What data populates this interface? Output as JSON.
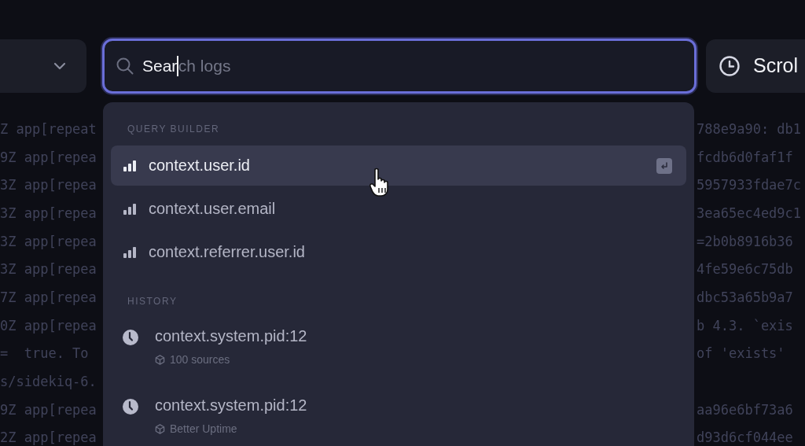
{
  "search": {
    "value": "Sear",
    "completion": "ch logs"
  },
  "right_button": {
    "label": "Scrol"
  },
  "log_lines": [
    {
      "left": "Z app[repeat",
      "right": "788e9a90: db1"
    },
    {
      "left": "9Z app[repea",
      "right": "fcdb6d0faf1f"
    },
    {
      "left": "3Z app[repea",
      "right": "5957933fdae7c"
    },
    {
      "left": "3Z app[repea",
      "right": "3ea65ec4ed9c1"
    },
    {
      "left": "3Z app[repea",
      "right": "=2b0b8916b36"
    },
    {
      "left": "3Z app[repea",
      "right": "4fe59e6c75db"
    },
    {
      "left": "7Z app[repea",
      "right": "dbc53a65b9a7"
    },
    {
      "left": "0Z app[repea",
      "right": "b 4.3. `exis"
    },
    {
      "left": "=  true. To",
      "right": "of 'exists'"
    },
    {
      "left": "s/sidekiq-6."
    },
    {
      "left": "9Z app[repea",
      "right": "aa96e6bf73a6"
    },
    {
      "left": "2Z app[repea",
      "right": "d93d6cf044ee"
    }
  ],
  "dropdown": {
    "sections": [
      {
        "title": "QUERY BUILDER",
        "items": [
          {
            "kind": "field",
            "label": "context.user.id",
            "selected": true
          },
          {
            "kind": "field",
            "label": "context.user.email",
            "selected": false
          },
          {
            "kind": "field",
            "label": "context.referrer.user.id",
            "selected": false
          }
        ]
      },
      {
        "title": "HISTORY",
        "items": [
          {
            "kind": "history",
            "label": "context.system.pid:12",
            "sub": "100 sources",
            "selected": false
          },
          {
            "kind": "history",
            "label": "context.system.pid:12",
            "sub": "Better Uptime",
            "selected": false
          }
        ]
      }
    ]
  }
}
